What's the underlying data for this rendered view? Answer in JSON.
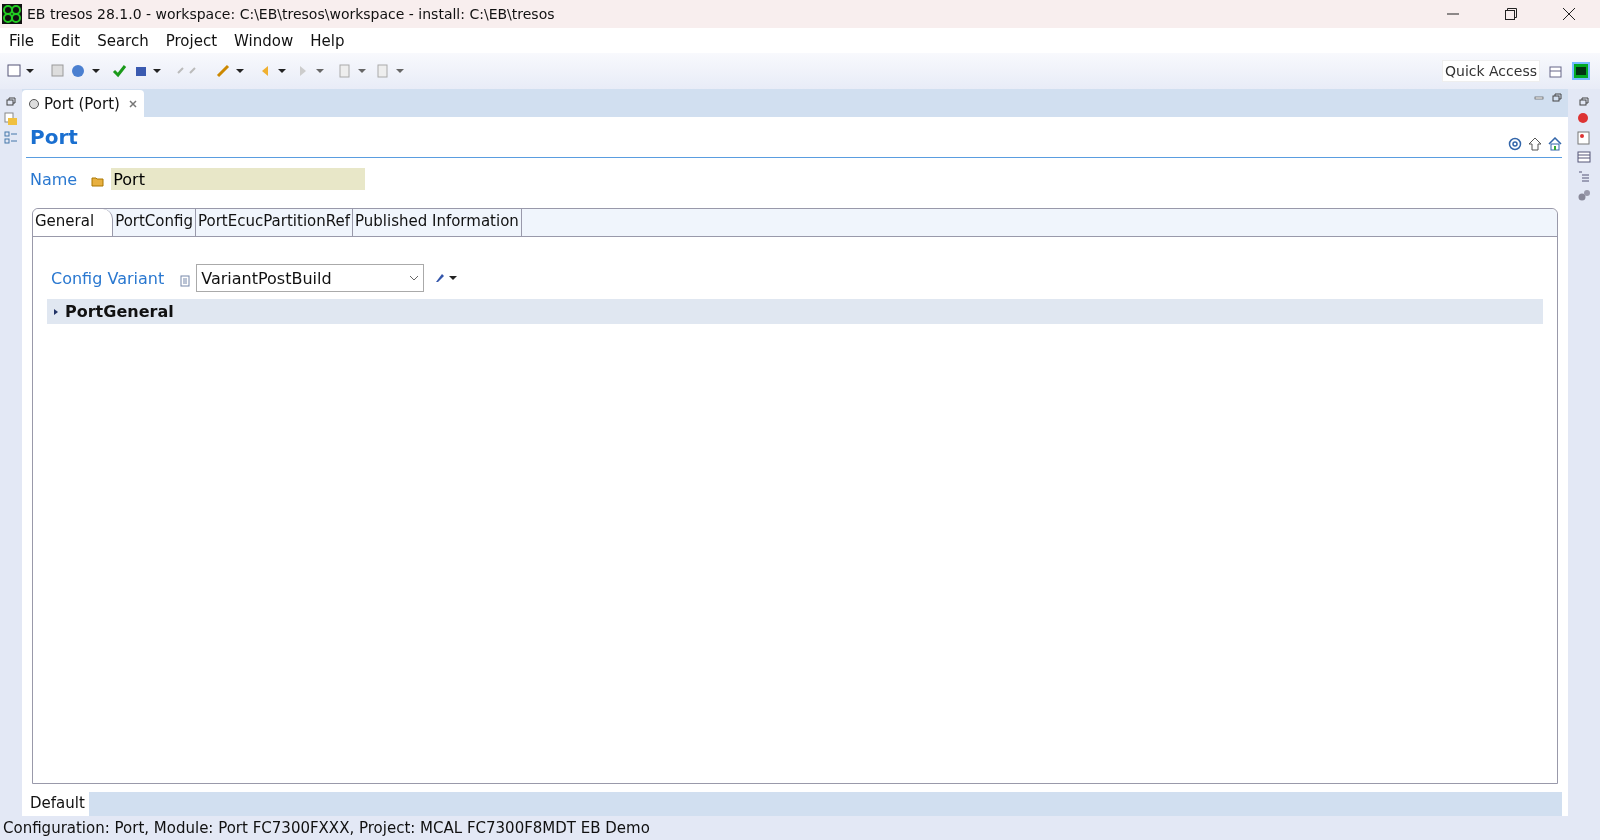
{
  "window": {
    "title": "EB tresos 28.1.0 - workspace: C:\\EB\\tresos\\workspace - install: C:\\EB\\tresos"
  },
  "menu": [
    "File",
    "Edit",
    "Search",
    "Project",
    "Window",
    "Help"
  ],
  "quick_access": {
    "placeholder": "Quick Access"
  },
  "editor_tab": {
    "label": "Port (Port)"
  },
  "editor": {
    "title": "Port",
    "name_label": "Name",
    "name_value": "Port",
    "tabs": [
      {
        "label": "General",
        "selected": true
      },
      {
        "label": "PortConfig",
        "selected": false
      },
      {
        "label": "PortEcucPartitionRef",
        "selected": false
      },
      {
        "label": "Published Information",
        "selected": false
      }
    ],
    "config_variant": {
      "label": "Config Variant",
      "value": "VariantPostBuild"
    },
    "sections": [
      {
        "label": "PortGeneral",
        "expanded": false
      }
    ]
  },
  "bottom_tabs": [
    {
      "label": "Default",
      "selected": true
    }
  ],
  "status_bar": "Configuration: Port, Module: Port FC7300FXXX, Project: MCAL FC7300F8MDT EB Demo"
}
